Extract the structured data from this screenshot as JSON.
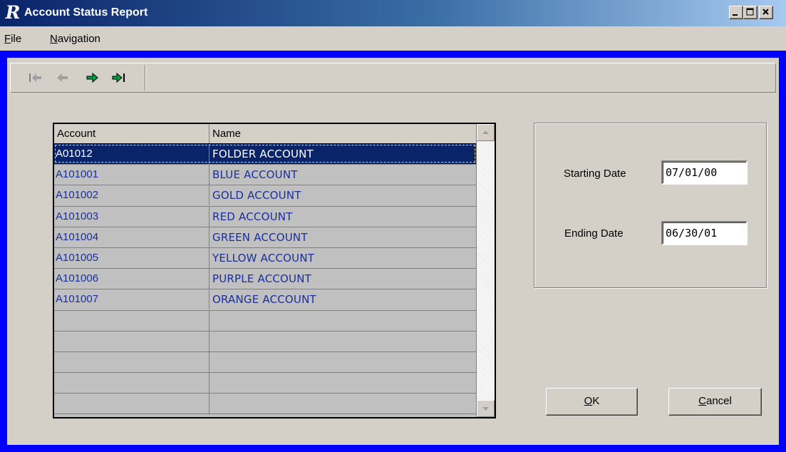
{
  "window": {
    "logo_letter": "R",
    "title": "Account Status Report"
  },
  "menu": {
    "file_mnemonic": "F",
    "file_rest": "ile",
    "nav_mnemonic": "N",
    "nav_rest": "avigation"
  },
  "toolbar": {
    "buttons": [
      "first-record-icon",
      "previous-record-icon",
      "next-record-icon",
      "last-record-icon"
    ]
  },
  "grid": {
    "columns": [
      "Account",
      "Name"
    ],
    "rows": [
      {
        "account": "A01012",
        "name": "FOLDER ACCOUNT"
      },
      {
        "account": "A101001",
        "name": "BLUE ACCOUNT"
      },
      {
        "account": "A101002",
        "name": "GOLD ACCOUNT"
      },
      {
        "account": "A101003",
        "name": "RED ACCOUNT"
      },
      {
        "account": "A101004",
        "name": "GREEN ACCOUNT"
      },
      {
        "account": "A101005",
        "name": "YELLOW ACCOUNT"
      },
      {
        "account": "A101006",
        "name": "PURPLE ACCOUNT"
      },
      {
        "account": "A101007",
        "name": "ORANGE ACCOUNT"
      },
      {
        "account": "",
        "name": ""
      },
      {
        "account": "",
        "name": ""
      },
      {
        "account": "",
        "name": ""
      },
      {
        "account": "",
        "name": ""
      },
      {
        "account": "",
        "name": ""
      }
    ],
    "selected_index": 0
  },
  "dates": {
    "starting_label": "Starting Date",
    "starting_value": "07/01/00",
    "ending_label": "Ending Date",
    "ending_value": "06/30/01"
  },
  "buttons": {
    "ok_mnemonic": "O",
    "ok_rest": "K",
    "cancel_mnemonic": "C",
    "cancel_rest": "ancel"
  },
  "colors": {
    "frame": "#0000ff",
    "titlebar_start": "#0a246a",
    "selection": "#0a246a",
    "row_text": "#1a2f9c"
  }
}
